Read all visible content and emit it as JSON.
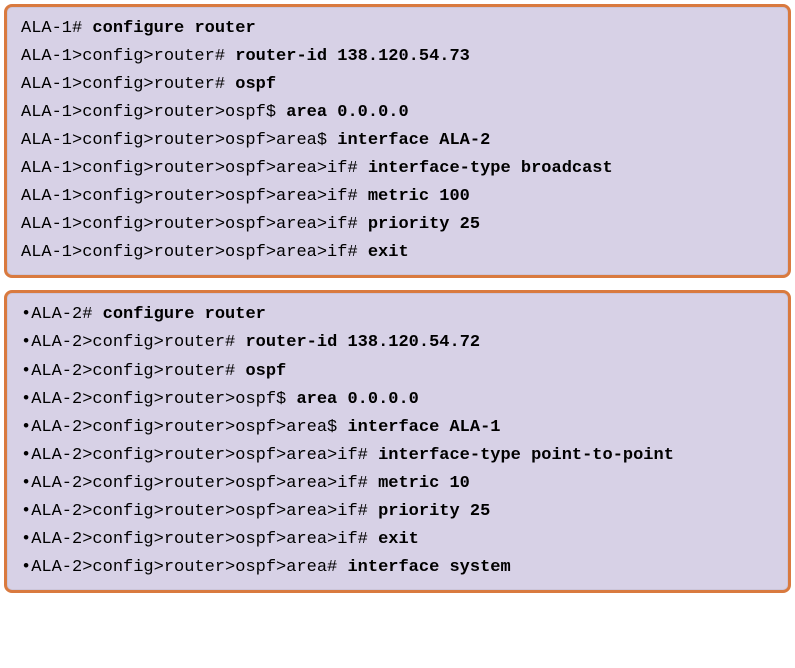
{
  "box1": {
    "lines": [
      {
        "bullet": "",
        "prompt": "ALA-1# ",
        "cmd": "configure router"
      },
      {
        "bullet": "",
        "prompt": "ALA-1>config>router# ",
        "cmd": "router-id 138.120.54.73"
      },
      {
        "bullet": "",
        "prompt": "ALA-1>config>router# ",
        "cmd": "ospf"
      },
      {
        "bullet": "",
        "prompt": "ALA-1>config>router>ospf$ ",
        "cmd": "area 0.0.0.0"
      },
      {
        "bullet": "",
        "prompt": "ALA-1>config>router>ospf>area$ ",
        "cmd": "interface ALA-2"
      },
      {
        "bullet": "",
        "prompt": "ALA-1>config>router>ospf>area>if# ",
        "cmd": "interface-type broadcast"
      },
      {
        "bullet": "",
        "prompt": "ALA-1>config>router>ospf>area>if# ",
        "cmd": "metric 100"
      },
      {
        "bullet": "",
        "prompt": "ALA-1>config>router>ospf>area>if# ",
        "cmd": "priority 25"
      },
      {
        "bullet": "",
        "prompt": "ALA-1>config>router>ospf>area>if# ",
        "cmd": "exit"
      }
    ]
  },
  "box2": {
    "lines": [
      {
        "bullet": "•",
        "prompt": "ALA-2# ",
        "cmd": "configure router"
      },
      {
        "bullet": "•",
        "prompt": "ALA-2>config>router# ",
        "cmd": "router-id 138.120.54.72"
      },
      {
        "bullet": "•",
        "prompt": "ALA-2>config>router# ",
        "cmd": "ospf"
      },
      {
        "bullet": "•",
        "prompt": "ALA-2>config>router>ospf$ ",
        "cmd": "area 0.0.0.0"
      },
      {
        "bullet": "•",
        "prompt": "ALA-2>config>router>ospf>area$ ",
        "cmd": "interface ALA-1"
      },
      {
        "bullet": "•",
        "prompt": "ALA-2>config>router>ospf>area>if# ",
        "cmd": "interface-type point-to-point"
      },
      {
        "bullet": "•",
        "prompt": "ALA-2>config>router>ospf>area>if# ",
        "cmd": "metric 10"
      },
      {
        "bullet": "•",
        "prompt": "ALA-2>config>router>ospf>area>if# ",
        "cmd": "priority 25"
      },
      {
        "bullet": "•",
        "prompt": "ALA-2>config>router>ospf>area>if# ",
        "cmd": "exit"
      },
      {
        "bullet": "•",
        "prompt": "ALA-2>config>router>ospf>area# ",
        "cmd": "interface system"
      }
    ]
  }
}
